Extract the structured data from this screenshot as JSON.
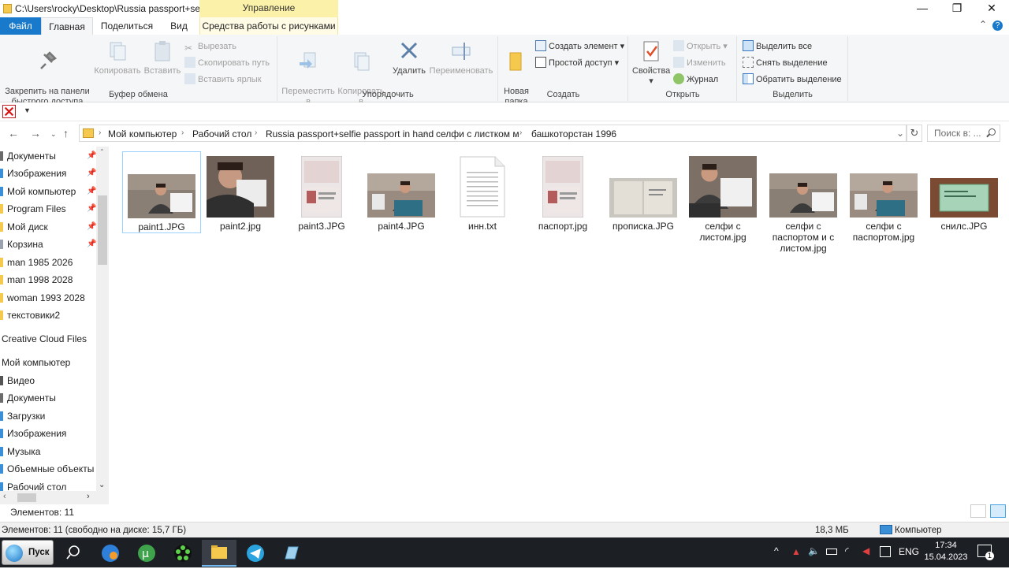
{
  "window": {
    "title": "C:\\Users\\rocky\\Desktop\\Russia passport+self...",
    "context_tab": "Управление",
    "minimize": "—",
    "maximize": "❐",
    "close": "✕"
  },
  "tabs": {
    "file": "Файл",
    "home": "Главная",
    "share": "Поделиться",
    "view": "Вид",
    "picture_tools": "Средства работы с рисунками",
    "help": "?"
  },
  "ribbon": {
    "clipboard": {
      "label": "Буфер обмена",
      "pin": "Закрепить на панели\nбыстрого доступа",
      "copy": "Копировать",
      "paste": "Вставить",
      "cut": "Вырезать",
      "copy_path": "Скопировать путь",
      "paste_shortcut": "Вставить ярлык"
    },
    "organize": {
      "label": "Упорядочить",
      "move_to": "Переместить\nв",
      "copy_to": "Копировать\nв",
      "delete": "Удалить",
      "rename": "Переименовать"
    },
    "new": {
      "label": "Создать",
      "new_folder": "Новая\nпапка",
      "new_item": "Создать элемент",
      "easy_access": "Простой доступ"
    },
    "open": {
      "label": "Открыть",
      "properties": "Свойства",
      "open": "Открыть",
      "edit": "Изменить",
      "history": "Журнал"
    },
    "select": {
      "label": "Выделить",
      "select_all": "Выделить все",
      "select_none": "Снять выделение",
      "invert": "Обратить выделение"
    }
  },
  "breadcrumb": [
    "Мой компьютер",
    "Рабочий стол",
    "Russia passport+selfie passport in hand",
    "селфи с листком м",
    "башкоторстан 1996"
  ],
  "search": {
    "placeholder": "Поиск в: ..."
  },
  "nav": {
    "items": [
      {
        "label": "Документы",
        "pinned": true,
        "color": "#6b6b6b"
      },
      {
        "label": "Изображения",
        "pinned": true,
        "color": "#3a8fd6"
      },
      {
        "label": "Мой компьютер",
        "pinned": true,
        "color": "#3a8fd6"
      },
      {
        "label": "Program Files",
        "pinned": true,
        "color": "#f4c94d"
      },
      {
        "label": "Мой диск",
        "pinned": true,
        "color": "#f4c94d"
      },
      {
        "label": "Корзина",
        "pinned": true,
        "color": "#9aa3ad"
      },
      {
        "label": "man 1985 2026",
        "pinned": false,
        "color": "#f4c94d"
      },
      {
        "label": "man 1998 2028",
        "pinned": false,
        "color": "#f4c94d"
      },
      {
        "label": "woman 1993 2028",
        "pinned": false,
        "color": "#f4c94d"
      },
      {
        "label": "текстовики2",
        "pinned": false,
        "color": "#f4c94d"
      },
      {
        "label": "Creative Cloud Files",
        "pinned": false,
        "color": ""
      },
      {
        "label": "Мой компьютер",
        "pinned": false,
        "color": ""
      },
      {
        "label": "Видео",
        "pinned": false,
        "color": "#555"
      },
      {
        "label": "Документы",
        "pinned": false,
        "color": "#6b6b6b"
      },
      {
        "label": "Загрузки",
        "pinned": false,
        "color": "#3a8fd6"
      },
      {
        "label": "Изображения",
        "pinned": false,
        "color": "#3a8fd6"
      },
      {
        "label": "Музыка",
        "pinned": false,
        "color": "#3a8fd6"
      },
      {
        "label": "Объемные объекты",
        "pinned": false,
        "color": "#3a8fd6"
      },
      {
        "label": "Рабочий стол",
        "pinned": false,
        "color": "#3a8fd6"
      }
    ]
  },
  "files": [
    {
      "name": "paint1.JPG",
      "kind": "photo-person-paper",
      "selected": true
    },
    {
      "name": "paint2.jpg",
      "kind": "photo-face-paper",
      "selected": false
    },
    {
      "name": "paint3.JPG",
      "kind": "passport",
      "selected": false
    },
    {
      "name": "paint4.JPG",
      "kind": "photo-person-laptop",
      "selected": false
    },
    {
      "name": "инн.txt",
      "kind": "text",
      "selected": false
    },
    {
      "name": "паспорт.jpg",
      "kind": "passport",
      "selected": false
    },
    {
      "name": "прописка.JPG",
      "kind": "document-open",
      "selected": false
    },
    {
      "name": "селфи с\nлистом.jpg",
      "kind": "photo-person-paper-tall",
      "selected": false
    },
    {
      "name": "селфи с\nпаспортом и с\nлистом.jpg",
      "kind": "photo-person-paper",
      "selected": false
    },
    {
      "name": "селфи с\nпаспортом.jpg",
      "kind": "photo-person-laptop",
      "selected": false
    },
    {
      "name": "снилс.JPG",
      "kind": "snils",
      "selected": false
    }
  ],
  "status": {
    "items_count": "Элементов: 11",
    "footer_left": "Элементов: 11 (свободно на диске: 15,7 ГБ)",
    "size": "18,3 МБ",
    "location": "Компьютер"
  },
  "taskbar": {
    "start": "Пуск",
    "lang": "ENG",
    "time": "17:34",
    "date": "15.04.2023",
    "notifications": "1"
  }
}
